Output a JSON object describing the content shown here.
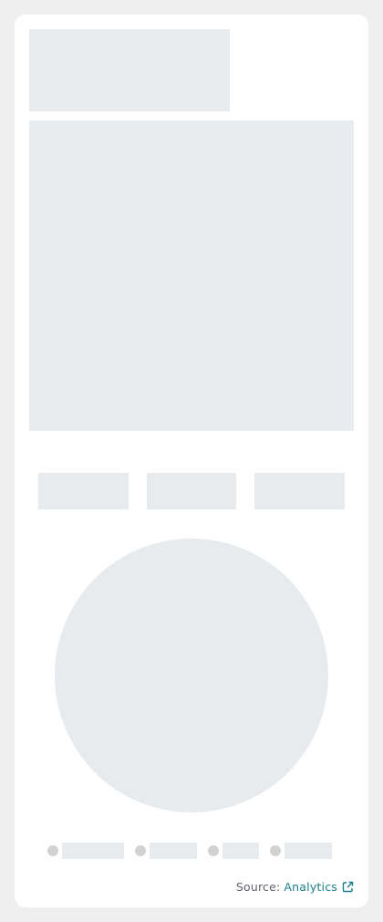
{
  "source": {
    "label": "Source:",
    "link_text": "Analytics",
    "icon": "external-link-icon"
  },
  "colors": {
    "background": "#efefef",
    "card": "#ffffff",
    "skeleton": "#e8ebee",
    "legend_dot": "#d2d2d2",
    "link": "#1a7f8a",
    "source_label": "#5f6368"
  }
}
